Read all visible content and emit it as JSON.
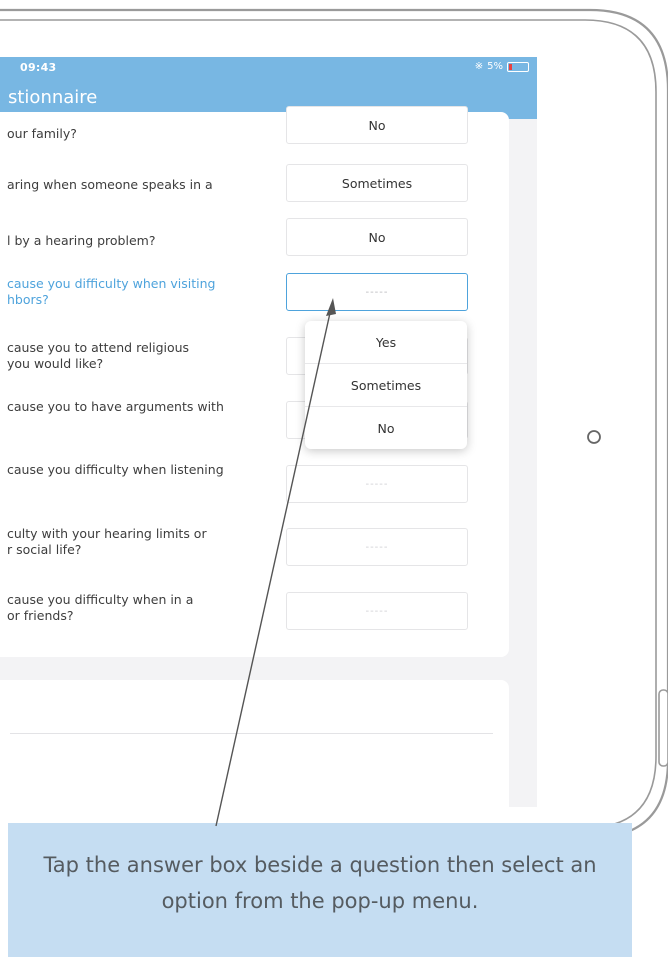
{
  "status_bar": {
    "time": "09:43",
    "battery": "5%",
    "bluetooth_icon": "bluetooth-icon"
  },
  "nav": {
    "title": "stionnaire"
  },
  "questions": [
    {
      "text": "our family?",
      "answer": "No"
    },
    {
      "text": "aring when someone speaks in a",
      "answer": "Sometimes"
    },
    {
      "text": "l by a hearing problem?",
      "answer": "No"
    },
    {
      "text": "cause you difficulty when visiting\nhbors?",
      "answer": "-----"
    },
    {
      "text": "cause you to attend religious\nyou would like?",
      "answer": ""
    },
    {
      "text": "cause you to have arguments with",
      "answer": ""
    },
    {
      "text": "cause you difficulty when listening",
      "answer": "-----"
    },
    {
      "text": "culty with your hearing limits or\nr social life?",
      "answer": "-----"
    },
    {
      "text": "cause you difficulty when in a\nor friends?",
      "answer": "-----"
    }
  ],
  "popup": {
    "options": [
      "Yes",
      "Sometimes",
      "No"
    ]
  },
  "callout": {
    "text": "Tap the answer box beside a question then select an option from the pop-up menu."
  },
  "colors": {
    "accent": "#78b7e3",
    "active": "#4ea3dc",
    "callout": "#c5ddf2"
  }
}
